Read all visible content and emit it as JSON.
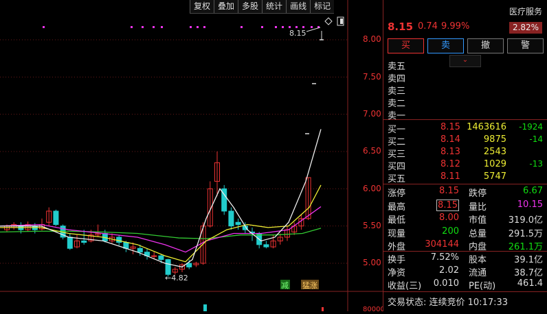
{
  "toolbar": [
    "复权",
    "叠加",
    "多股",
    "统计",
    "画线",
    "标记"
  ],
  "price_axis": [
    "8.00",
    "7.50",
    "7.00",
    "6.50",
    "6.00",
    "5.50",
    "5.00"
  ],
  "volume_axis_label": "80000",
  "chart_annotations": {
    "high": "8.15",
    "low": "4.82",
    "tag_reduce": "减",
    "tag_surge": "猛涨"
  },
  "quote": {
    "sector": "医疗服务",
    "sector_pct": "2.82%",
    "price": "8.15",
    "change": "0.74",
    "change_pct": "9.99%"
  },
  "buttons": {
    "buy": "买",
    "sell": "卖",
    "cancel": "撤",
    "alert": "警"
  },
  "collapse_icon": "⌄",
  "asks": [
    {
      "label": "卖五",
      "price": "",
      "vol": "",
      "delta": ""
    },
    {
      "label": "卖四",
      "price": "",
      "vol": "",
      "delta": ""
    },
    {
      "label": "卖三",
      "price": "",
      "vol": "",
      "delta": ""
    },
    {
      "label": "卖二",
      "price": "",
      "vol": "",
      "delta": ""
    },
    {
      "label": "卖一",
      "price": "",
      "vol": "",
      "delta": ""
    }
  ],
  "bids": [
    {
      "label": "买一",
      "price": "8.15",
      "vol": "1463616",
      "delta": "-1924"
    },
    {
      "label": "买二",
      "price": "8.14",
      "vol": "9875",
      "delta": "-14"
    },
    {
      "label": "买三",
      "price": "8.13",
      "vol": "2543",
      "delta": ""
    },
    {
      "label": "买四",
      "price": "8.12",
      "vol": "1029",
      "delta": "-13"
    },
    {
      "label": "买五",
      "price": "8.11",
      "vol": "5747",
      "delta": ""
    }
  ],
  "stats1": [
    {
      "l1": "涨停",
      "v1": "8.15",
      "l2": "跌停",
      "v2": "6.67"
    },
    {
      "l1": "最高",
      "v1": "8.15",
      "l2": "量比",
      "v2": "10.15"
    },
    {
      "l1": "最低",
      "v1": "8.00",
      "l2": "市值",
      "v2": "319.0亿"
    },
    {
      "l1": "现量",
      "v1": "200",
      "l2": "总量",
      "v2": "291.5万"
    },
    {
      "l1": "外盘",
      "v1": "304144",
      "l2": "内盘",
      "v2": "261.1万"
    }
  ],
  "stats2": [
    {
      "l1": "换手",
      "v1": "7.52%",
      "l2": "股本",
      "v2": "39.1亿"
    },
    {
      "l1": "净资",
      "v1": "2.02",
      "l2": "流通",
      "v2": "38.7亿"
    },
    {
      "l1": "收益(三)",
      "v1": "0.010",
      "l2": "PE(动)",
      "v2": "461.4"
    }
  ],
  "status": "交易状态: 连续竞价 10:17:33"
}
